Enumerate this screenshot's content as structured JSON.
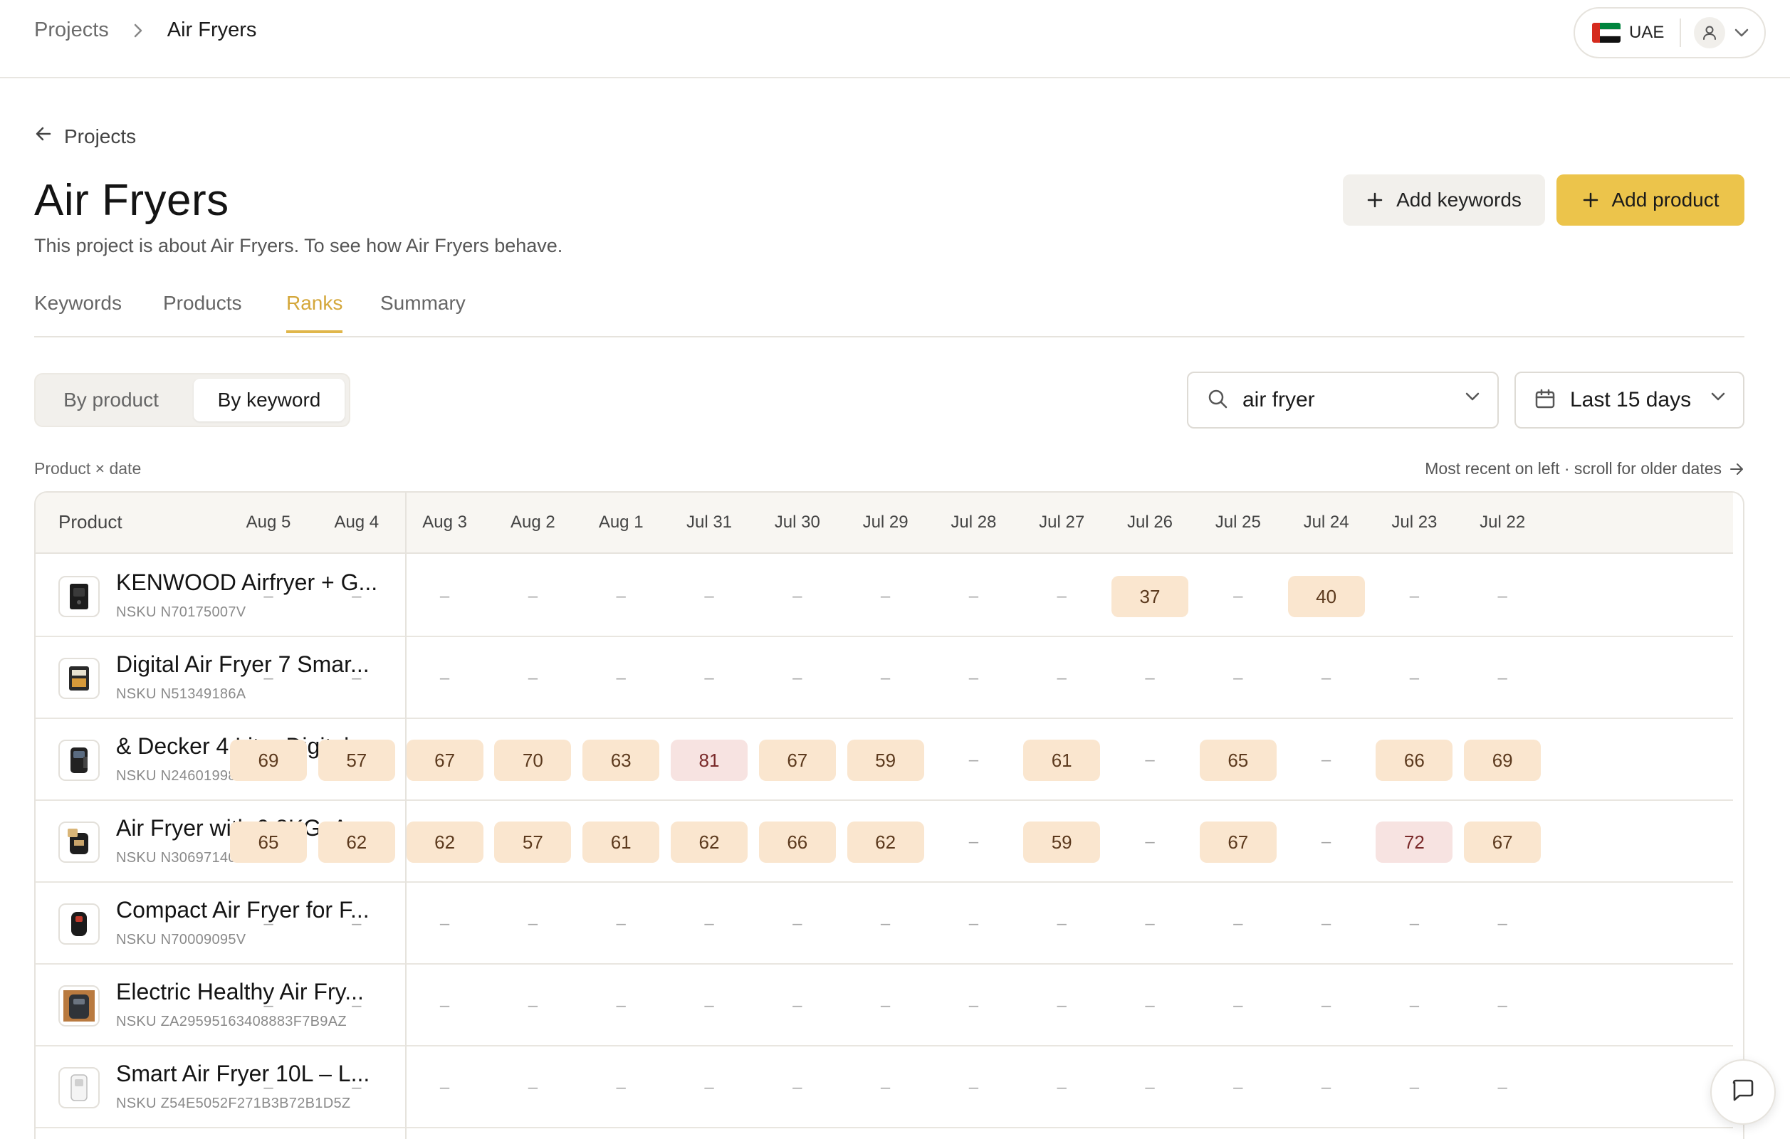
{
  "breadcrumb": {
    "parent": "Projects",
    "current": "Air Fryers"
  },
  "account": {
    "country": "UAE"
  },
  "back_link": "Projects",
  "project": {
    "title": "Air Fryers",
    "description": "This project is about Air Fryers. To see how Air Fryers behave."
  },
  "actions": {
    "add_keywords": "Add keywords",
    "add_product": "Add product"
  },
  "tabs": [
    {
      "label": "Keywords"
    },
    {
      "label": "Products"
    },
    {
      "label": "Ranks",
      "active": true
    },
    {
      "label": "Summary"
    }
  ],
  "view_toggle": {
    "by_product": "By product",
    "by_keyword": "By keyword",
    "selected": "By keyword"
  },
  "filters": {
    "keyword": "air fryer",
    "date_range": "Last 15 days"
  },
  "table_meta": {
    "left": "Product × date",
    "right": "Most recent on left · scroll for older dates"
  },
  "table": {
    "product_header": "Product",
    "dates": [
      "Aug 5",
      "Aug 4",
      "Aug 3",
      "Aug 2",
      "Aug 1",
      "Jul 31",
      "Jul 30",
      "Jul 29",
      "Jul 28",
      "Jul 27",
      "Jul 26",
      "Jul 25",
      "Jul 24",
      "Jul 23",
      "Jul 22"
    ],
    "rows": [
      {
        "name": "KENWOOD Airfryer + G...",
        "sku": "NSKU N70175007V",
        "ranks": [
          "–",
          "–",
          "–",
          "–",
          "–",
          "–",
          "–",
          "–",
          "–",
          "–",
          "37",
          "–",
          "40",
          "–",
          "–"
        ]
      },
      {
        "name": "Digital Air Fryer  7 Smar...",
        "sku": "NSKU N51349186A",
        "ranks": [
          "–",
          "–",
          "–",
          "–",
          "–",
          "–",
          "–",
          "–",
          "–",
          "–",
          "–",
          "–",
          "–",
          "–",
          "–"
        ]
      },
      {
        "name": "& Decker 4 Liter Digital ...",
        "sku": "NSKU N24601998A",
        "ranks": [
          "69",
          "57",
          "67",
          "70",
          "63",
          "81",
          "67",
          "59",
          "–",
          "61",
          "–",
          "65",
          "–",
          "66",
          "69"
        ]
      },
      {
        "name": "Air Fryer with 0.8KG, An...",
        "sku": "NSKU N30697140A",
        "ranks": [
          "65",
          "62",
          "62",
          "57",
          "61",
          "62",
          "66",
          "62",
          "–",
          "59",
          "–",
          "67",
          "–",
          "72",
          "67"
        ]
      },
      {
        "name": "Compact Air Fryer for F...",
        "sku": "NSKU N70009095V",
        "ranks": [
          "–",
          "–",
          "–",
          "–",
          "–",
          "–",
          "–",
          "–",
          "–",
          "–",
          "–",
          "–",
          "–",
          "–",
          "–"
        ]
      },
      {
        "name": "Electric Healthy Air Fry...",
        "sku": "NSKU ZA29595163408883F7B9AZ",
        "ranks": [
          "–",
          "–",
          "–",
          "–",
          "–",
          "–",
          "–",
          "–",
          "–",
          "–",
          "–",
          "–",
          "–",
          "–",
          "–"
        ]
      },
      {
        "name": "Smart Air Fryer 10L – L...",
        "sku": "NSKU Z54E5052F271B3B72B1D5Z",
        "ranks": [
          "–",
          "–",
          "–",
          "–",
          "–",
          "–",
          "–",
          "–",
          "–",
          "–",
          "–",
          "–",
          "–",
          "–",
          "–"
        ]
      }
    ]
  },
  "colors": {
    "accent": "#ecc44b",
    "tab_active": "#d4a73a",
    "rank_bg": "#fae6cf",
    "rank_bad_bg": "#f7e3e1"
  }
}
